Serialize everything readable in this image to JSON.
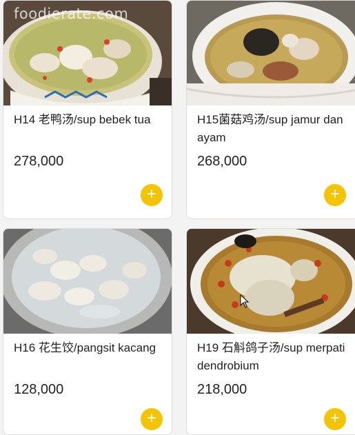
{
  "watermark": "foodierate.com",
  "products": [
    {
      "name": "H14 老鸭汤/sup bebek tua",
      "price": "278,000",
      "image": "duck-soup-photo"
    },
    {
      "name": "H15菌菇鸡汤/sup jamur dan ayam",
      "price": "268,000",
      "image": "mushroom-chicken-soup-photo"
    },
    {
      "name": "H16 花生饺/pangsit kacang",
      "price": "128,000",
      "image": "peanut-dumplings-photo"
    },
    {
      "name": "H19 石斛鸽子汤/sup merpati dendrobium",
      "price": "218,000",
      "image": "pigeon-dendrobium-soup-photo"
    }
  ],
  "add_button_symbol": "+",
  "colors": {
    "accent": "#f5c400",
    "background": "#f3f3f3"
  }
}
